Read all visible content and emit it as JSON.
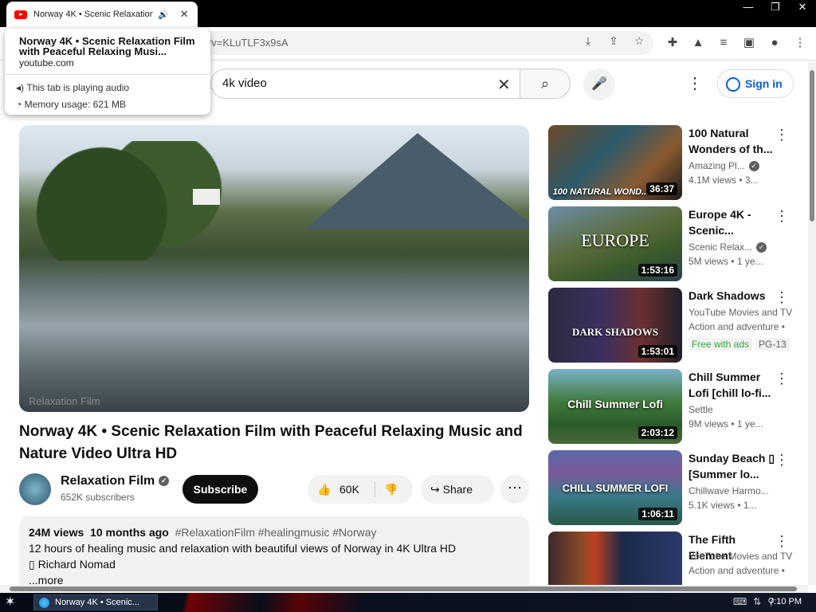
{
  "browser": {
    "tab_title": "Norway 4K • Scenic Relaxation",
    "tab_audio_icon": "speaker-icon",
    "tab_close": "✕",
    "window_controls": [
      "—",
      "❐",
      "✕"
    ],
    "url": "?v=KLuTLF3x9sA"
  },
  "tooltip": {
    "title": "Norway 4K • Scenic Relaxation Film with Peaceful Relaxing Musi...",
    "domain": "youtube.com",
    "audio": "This tab is playing audio",
    "memory": "Memory usage: 621 MB"
  },
  "header": {
    "search_value": "4k video",
    "sign_in": "Sign in"
  },
  "video": {
    "watermark": "Relaxation Film",
    "title": "Norway 4K • Scenic Relaxation Film with Peaceful Relaxing Music and Nature Video Ultra HD",
    "channel": "Relaxation Film",
    "subscribers": "652K subscribers",
    "subscribe": "Subscribe",
    "likes": "60K",
    "share": "Share",
    "views": "24M views",
    "age": "10 months ago",
    "tags": "#RelaxationFilm #healingmusic #Norway",
    "desc_line1": "12 hours of healing music and relaxation with beautiful views of Norway in 4K Ultra HD",
    "desc_line2": "▯ Richard Nomad",
    "desc_more": "...more"
  },
  "recommendations": [
    {
      "title": "100 Natural Wonders of th...",
      "channel": "Amazing Pl...",
      "meta": "4.1M views  • 3...",
      "duration": "36:37",
      "thumb_label": "100 NATURAL WOND..."
    },
    {
      "title": "Europe 4K - Scenic...",
      "channel": "Scenic Relax...",
      "meta": "5M views  • 1 ye...",
      "duration": "1:53:16",
      "thumb_label": "EUROPE"
    },
    {
      "title": "Dark Shadows",
      "channel": "YouTube Movies and TV",
      "meta": "Action and adventure •",
      "duration": "1:53:01",
      "thumb_label": "DARK SHADOWS",
      "badge1": "Free with ads",
      "badge2": "PG-13"
    },
    {
      "title": "Chill Summer Lofi [chill lo-fi...",
      "channel": "Settle",
      "meta": "9M views  • 1 ye...",
      "duration": "2:03:12",
      "thumb_label": "Chill Summer Lofi"
    },
    {
      "title": "Sunday Beach ▯ [Summer lo...",
      "channel": "Chillwave Harmo...",
      "meta": "5.1K views  • 1...",
      "duration": "1:06:11",
      "thumb_label": "CHILL SUMMER LOFI"
    },
    {
      "title": "The Fifth Element",
      "channel": "YouTube Movies and TV",
      "meta": "Action and adventure •",
      "duration": "",
      "thumb_label": ""
    }
  ],
  "taskbar": {
    "task_label": "Norway 4K • Scenic...",
    "clock": "7:10 PM"
  },
  "colors": {
    "accent": "#065fd4",
    "youtube_red": "#ff0000",
    "free_green": "#2ba640"
  }
}
